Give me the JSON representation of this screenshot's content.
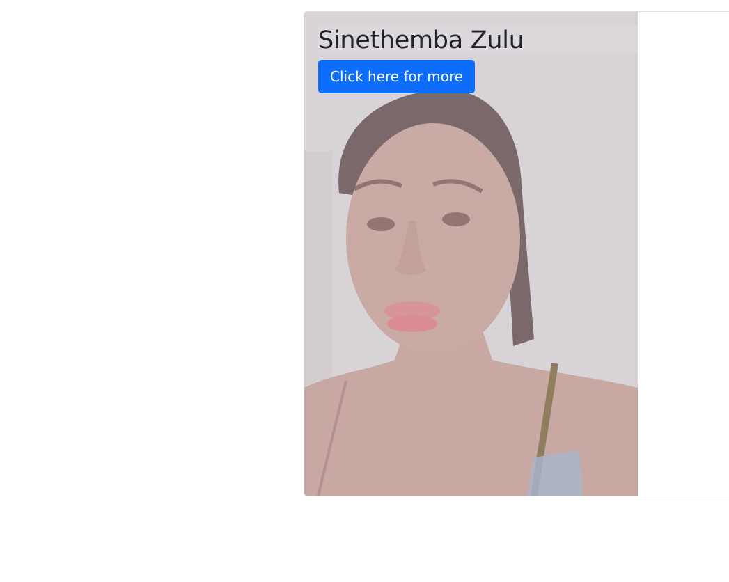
{
  "card": {
    "title": "Sinethemba Zulu",
    "button_label": "Click here for more"
  },
  "colors": {
    "primary": "#0d6efd",
    "title_text": "#212529",
    "photo_overlay_tone": "#d7d3d6"
  }
}
